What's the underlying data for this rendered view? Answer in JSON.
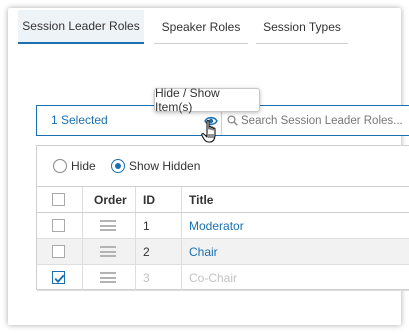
{
  "tabs": [
    {
      "label": "Session Leader Roles",
      "active": true
    },
    {
      "label": "Speaker Roles",
      "active": false
    },
    {
      "label": "Session Types",
      "active": false
    }
  ],
  "filter": {
    "selected_label": "1 Selected",
    "eye_icon": "eye-icon",
    "search_icon": "search-icon",
    "search_placeholder": "Search Session Leader Roles..."
  },
  "tooltip": {
    "text": "Hide / Show Item(s)"
  },
  "visibility": {
    "hide_label": "Hide",
    "show_hidden_label": "Show Hidden",
    "selected": "show_hidden"
  },
  "table": {
    "columns": [
      "",
      "Order",
      "ID",
      "Title"
    ],
    "rows": [
      {
        "checked": false,
        "id": "1",
        "title": "Moderator",
        "hidden": false
      },
      {
        "checked": false,
        "id": "2",
        "title": "Chair",
        "hidden": false
      },
      {
        "checked": true,
        "id": "3",
        "title": "Co-Chair",
        "hidden": true
      }
    ]
  },
  "colors": {
    "accent": "#1a6fb0",
    "active_tab_bg": "#eef3f8",
    "alt_row_bg": "#f2f2f2",
    "muted_text": "#c3c3c3"
  }
}
